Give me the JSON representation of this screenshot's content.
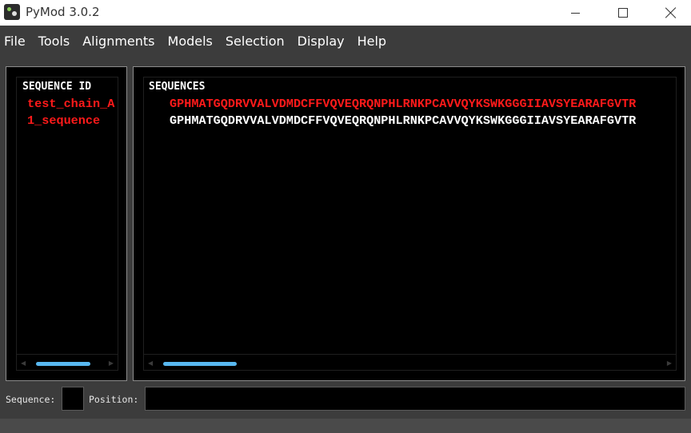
{
  "window": {
    "title": "PyMod 3.0.2",
    "icon": "pymod-app-icon",
    "controls": [
      "minimize-icon",
      "maximize-icon",
      "close-icon"
    ]
  },
  "menu": {
    "items": [
      {
        "label": "File"
      },
      {
        "label": "Tools"
      },
      {
        "label": "Alignments"
      },
      {
        "label": "Models"
      },
      {
        "label": "Selection"
      },
      {
        "label": "Display"
      },
      {
        "label": "Help"
      }
    ]
  },
  "left_panel": {
    "header": "SEQUENCE ID",
    "items": [
      {
        "label": "test_chain_A",
        "color": "#ff1a1a"
      },
      {
        "label": "1_sequence",
        "color": "#ff1a1a"
      }
    ]
  },
  "right_panel": {
    "header": "SEQUENCES",
    "items": [
      {
        "sequence": "GPHMATGQDRVVALVDMDCFFVQVEQRQNPHLRNKPCAVVQYKSWKGGGIIAVSYEARAFGVTR",
        "color": "#ff1a1a"
      },
      {
        "sequence": "GPHMATGQDRVVALVDMDCFFVQVEQRQNPHLRNKPCAVVQYKSWKGGGIIAVSYEARAFGVTR",
        "color": "#ffffff"
      }
    ]
  },
  "bottom": {
    "sequence_label": "Sequence:",
    "sequence_value": "",
    "position_label": "Position:",
    "position_value": ""
  },
  "colors": {
    "selected_text": "#ff1a1a",
    "normal_text": "#ffffff",
    "scrollbar_thumb": "#58b8f0",
    "background": "#000000",
    "chrome": "#3c3c3c"
  }
}
